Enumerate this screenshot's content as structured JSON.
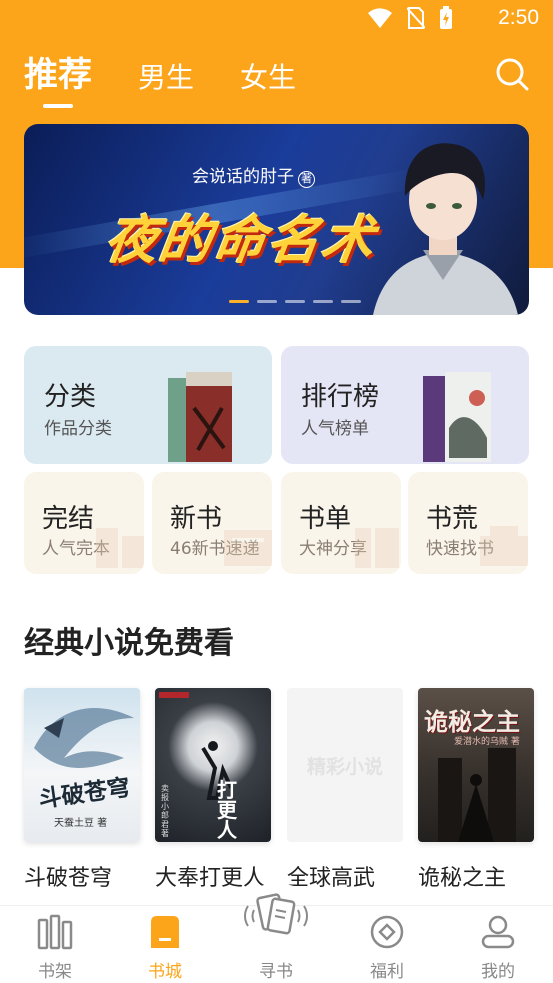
{
  "status_bar": {
    "time": "2:50"
  },
  "tabs": [
    {
      "label": "推荐",
      "active": true
    },
    {
      "label": "男生",
      "active": false
    },
    {
      "label": "女生",
      "active": false
    }
  ],
  "banner": {
    "author": "会说话的肘子",
    "author_badge": "著",
    "title": "夜的命名术",
    "slide_count": 5,
    "active_slide": 1
  },
  "categories": {
    "big": [
      {
        "title": "分类",
        "subtitle": "作品分类"
      },
      {
        "title": "排行榜",
        "subtitle": "人气榜单"
      }
    ],
    "small": [
      {
        "title": "完结",
        "subtitle": "人气完本"
      },
      {
        "title": "新书",
        "subtitle": "46新书速递"
      },
      {
        "title": "书单",
        "subtitle": "大神分享"
      },
      {
        "title": "书荒",
        "subtitle": "快速找书"
      }
    ]
  },
  "section": {
    "title": "经典小说免费看",
    "books": [
      {
        "name": "斗破苍穹",
        "cover_title": "斗破苍穹",
        "cover_author": "天蚕土豆 著"
      },
      {
        "name": "大奉打更人",
        "cover_title": "打更人",
        "cover_author": "卖报小郎君 著"
      },
      {
        "name": "全球高武",
        "cover_title": "精彩小说",
        "cover_author": ""
      },
      {
        "name": "诡秘之主",
        "cover_title": "诡秘之主",
        "cover_author": "爱潜水的乌贼 著"
      }
    ]
  },
  "bottom_nav": [
    {
      "label": "书架",
      "icon": "bookshelf-icon",
      "active": false
    },
    {
      "label": "书城",
      "icon": "bookstore-icon",
      "active": true
    },
    {
      "label": "寻书",
      "icon": "find-book-icon",
      "active": false
    },
    {
      "label": "福利",
      "icon": "coin-icon",
      "active": false
    },
    {
      "label": "我的",
      "icon": "profile-icon",
      "active": false
    }
  ],
  "colors": {
    "accent": "#fca51a",
    "card_blue": "#dbe9f1",
    "card_lavender": "#e5e6f5",
    "card_cream": "#faf5eb"
  }
}
